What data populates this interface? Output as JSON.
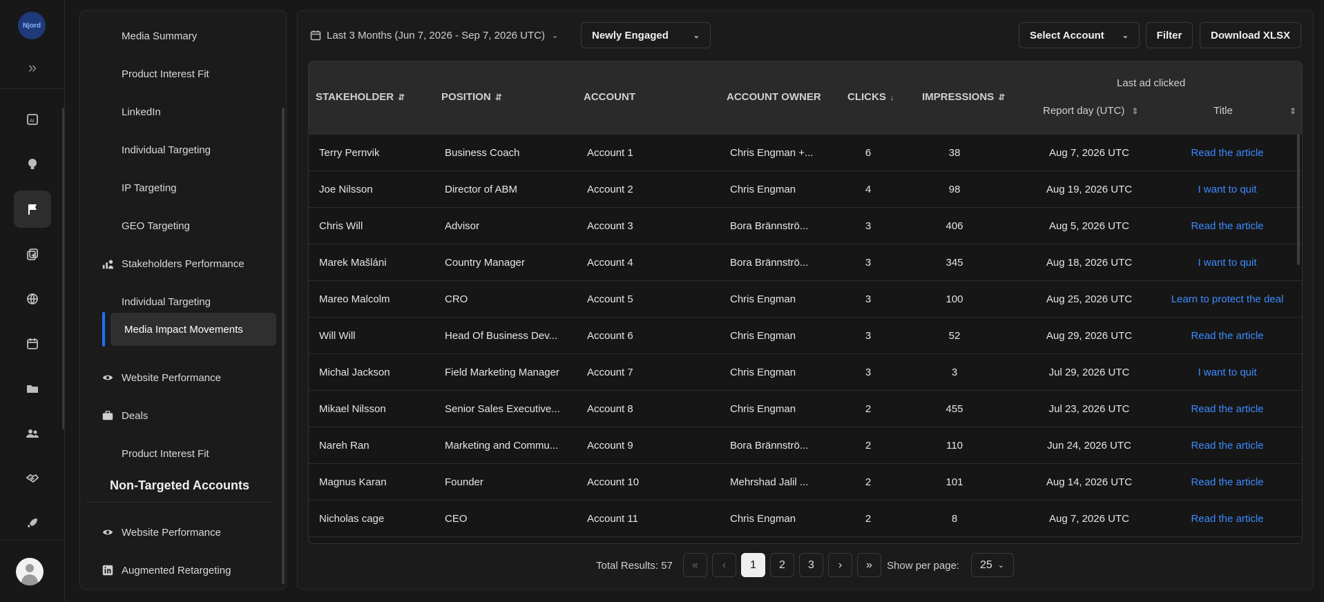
{
  "app": {
    "logo_text": "Njord"
  },
  "rail": {
    "icons": [
      "ai-report-icon",
      "lightbulb-icon",
      "flag-icon",
      "add-document-icon",
      "globe-icon",
      "calendar-icon",
      "folder-icon",
      "people-icon",
      "handshake-icon",
      "rocket-icon"
    ],
    "active": "flag-icon"
  },
  "nav": {
    "items": [
      {
        "label": "Media Summary"
      },
      {
        "label": "Product Interest Fit"
      },
      {
        "label": "LinkedIn"
      },
      {
        "label": "Individual Targeting"
      },
      {
        "label": "IP Targeting"
      },
      {
        "label": "GEO Targeting"
      },
      {
        "label": "Stakeholders Performance",
        "icon": "stakeholders-icon"
      },
      {
        "label": "Individual Targeting"
      },
      {
        "label": "Media Impact Movements",
        "active": true
      },
      {
        "label": "Website Performance",
        "icon": "website-performance-icon"
      },
      {
        "label": "Deals",
        "icon": "briefcase-icon"
      },
      {
        "label": "Product Interest Fit"
      }
    ],
    "section_title": "Non-Targeted Accounts",
    "section_items": [
      {
        "label": "Website Performance",
        "icon": "website-performance-icon"
      },
      {
        "label": "Augmented Retargeting",
        "icon": "linkedin-icon"
      }
    ]
  },
  "toolbar": {
    "date_range": "Last 3 Months (Jun 7, 2026 - Sep 7, 2026 UTC)",
    "segment_select": "Newly Engaged",
    "account_select": "Select Account",
    "filter_label": "Filter",
    "download_label": "Download XLSX"
  },
  "table": {
    "headers": {
      "stakeholder": "STAKEHOLDER",
      "position": "POSITION",
      "account": "ACCOUNT",
      "account_owner": "ACCOUNT OWNER",
      "clicks": "CLICKS",
      "impressions": "IMPRESSIONS",
      "last_ad_group": "Last ad clicked",
      "report_day": "Report day (UTC)",
      "title": "Title"
    },
    "rows": [
      {
        "stakeholder": "Terry Pernvik",
        "position": "Business Coach",
        "account": "Account 1",
        "owner": "Chris Engman +...",
        "clicks": "6",
        "impressions": "38",
        "report_day": "Aug 7, 2026 UTC",
        "title": "Read the article"
      },
      {
        "stakeholder": "Joe Nilsson",
        "position": "Director of ABM",
        "account": "Account 2",
        "owner": "Chris Engman",
        "clicks": "4",
        "impressions": "98",
        "report_day": "Aug 19, 2026 UTC",
        "title": "I want to quit"
      },
      {
        "stakeholder": "Chris Will",
        "position": "Advisor",
        "account": "Account 3",
        "owner": "Bora Brännströ...",
        "clicks": "3",
        "impressions": "406",
        "report_day": "Aug 5, 2026 UTC",
        "title": "Read the article"
      },
      {
        "stakeholder": "Marek Mašláni",
        "position": "Country Manager",
        "account": "Account 4",
        "owner": "Bora Brännströ...",
        "clicks": "3",
        "impressions": "345",
        "report_day": "Aug 18, 2026 UTC",
        "title": "I want to quit"
      },
      {
        "stakeholder": "Mareo Malcolm",
        "position": "CRO",
        "account": "Account 5",
        "owner": "Chris Engman",
        "clicks": "3",
        "impressions": "100",
        "report_day": "Aug 25, 2026 UTC",
        "title": "Learn to protect the deal"
      },
      {
        "stakeholder": "Will Will",
        "position": "Head Of Business Dev...",
        "account": "Account 6",
        "owner": "Chris Engman",
        "clicks": "3",
        "impressions": "52",
        "report_day": "Aug 29, 2026 UTC",
        "title": "Read the article"
      },
      {
        "stakeholder": "Michal Jackson",
        "position": "Field Marketing Manager",
        "account": "Account 7",
        "owner": "Chris Engman",
        "clicks": "3",
        "impressions": "3",
        "report_day": "Jul 29, 2026 UTC",
        "title": "I want to quit"
      },
      {
        "stakeholder": "Mikael Nilsson",
        "position": "Senior Sales Executive...",
        "account": "Account 8",
        "owner": "Chris Engman",
        "clicks": "2",
        "impressions": "455",
        "report_day": "Jul 23, 2026 UTC",
        "title": "Read the article"
      },
      {
        "stakeholder": "Nareh Ran",
        "position": "Marketing and Commu...",
        "account": "Account 9",
        "owner": "Bora Brännströ...",
        "clicks": "2",
        "impressions": "110",
        "report_day": "Jun 24, 2026 UTC",
        "title": "Read the article"
      },
      {
        "stakeholder": "Magnus Karan",
        "position": "Founder",
        "account": "Account 10",
        "owner": "Mehrshad Jalil ...",
        "clicks": "2",
        "impressions": "101",
        "report_day": "Aug 14, 2026 UTC",
        "title": "Read the article"
      },
      {
        "stakeholder": "Nicholas cage",
        "position": "CEO",
        "account": "Account 11",
        "owner": "Chris Engman",
        "clicks": "2",
        "impressions": "8",
        "report_day": "Aug 7, 2026 UTC",
        "title": "Read the article"
      }
    ]
  },
  "pagination": {
    "total_label": "Total Results: 57",
    "pages": [
      "1",
      "2",
      "3"
    ],
    "current_page": "1",
    "per_page_label": "Show per page:",
    "per_page_value": "25"
  },
  "colors": {
    "accent": "#1f6fff",
    "link": "#3d8bff",
    "background": "#181818"
  }
}
